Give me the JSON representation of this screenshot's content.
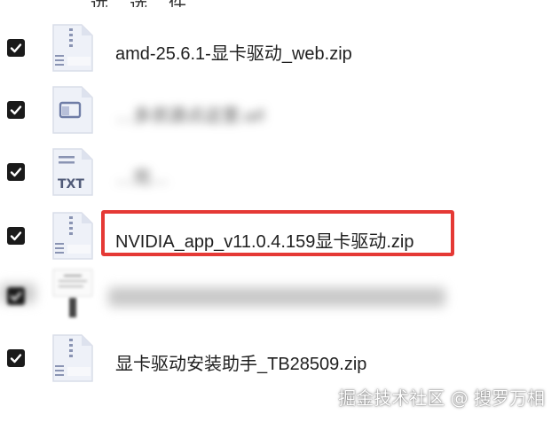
{
  "top_fragment": "…远…选…件",
  "files": [
    {
      "name": "amd-25.6.1-显卡驱动_web.zip",
      "icon": "zip-icon",
      "checked": true,
      "blurred": false
    },
    {
      "name": "…多资源点这里.url",
      "icon": "url-icon",
      "checked": true,
      "blurred": true
    },
    {
      "name": "…完…",
      "icon": "txt-icon",
      "icon_text": "TXT",
      "checked": true,
      "blurred": true
    },
    {
      "name": "NVIDIA_app_v11.0.4.159显卡驱动.zip",
      "icon": "zip-icon",
      "checked": true,
      "blurred": false,
      "highlighted": true
    },
    {
      "name": "",
      "icon": "document-thumbnail-icon",
      "checked": true,
      "blurred": true
    },
    {
      "name": "显卡驱动安装助手_TB28509.zip",
      "icon": "zip-icon",
      "checked": true,
      "blurred": false
    }
  ],
  "watermark": "掘金技术社区 @ 搜罗万相",
  "colors": {
    "highlight": "#e53935",
    "checkbox": "#1a1a1a"
  }
}
